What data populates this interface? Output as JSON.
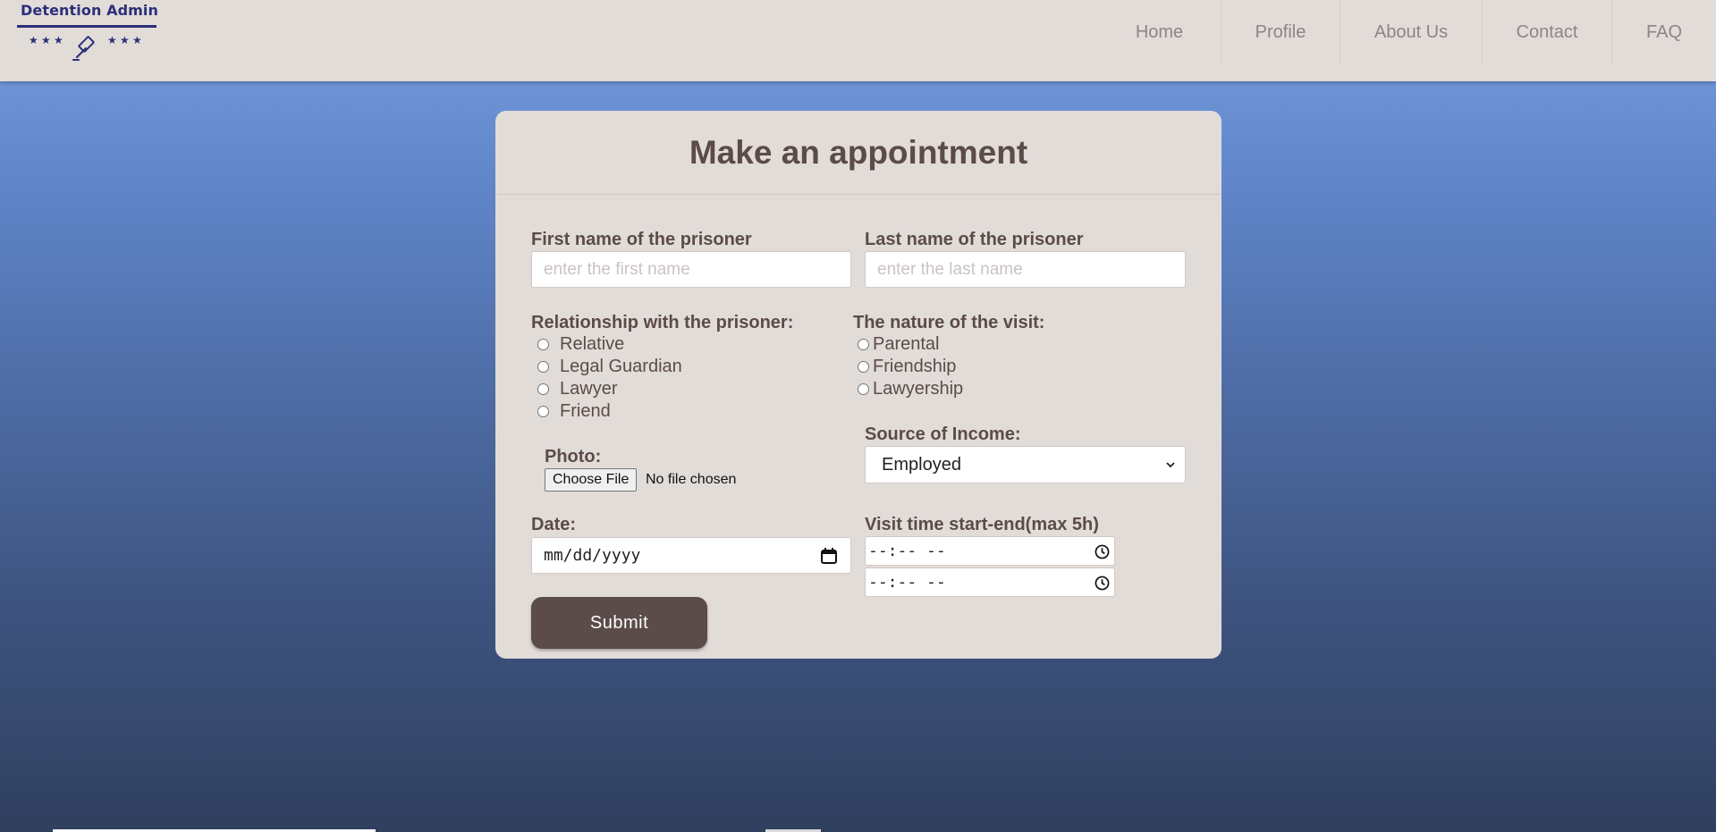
{
  "brand": {
    "name": "Detention Admin",
    "logo_icon": "gavel-icon",
    "accent_color": "#2a2f78"
  },
  "nav": {
    "items": [
      {
        "label": "Home"
      },
      {
        "label": "Profile"
      },
      {
        "label": "About Us"
      },
      {
        "label": "Contact"
      },
      {
        "label": "FAQ"
      }
    ]
  },
  "form": {
    "title": "Make an appointment",
    "first_name": {
      "label": "First name of the prisoner",
      "placeholder": "enter the first name",
      "value": ""
    },
    "last_name": {
      "label": "Last name of the prisoner",
      "placeholder": "enter the last name",
      "value": ""
    },
    "relationship": {
      "label": "Relationship with the prisoner:",
      "options": [
        "Relative",
        "Legal Guardian",
        "Lawyer",
        "Friend"
      ]
    },
    "visit_nature": {
      "label": "The nature of the visit:",
      "options": [
        "Parental",
        "Friendship",
        "Lawyership"
      ]
    },
    "photo": {
      "label": "Photo:",
      "button_label": "Choose File",
      "status": "No file chosen"
    },
    "income": {
      "label": "Source of Income:",
      "selected": "Employed"
    },
    "date": {
      "label": "Date:",
      "placeholder": "mm/dd/yyyy"
    },
    "visit_time": {
      "label": "Visit time start-end(max 5h)",
      "start_placeholder": "--:-- --",
      "end_placeholder": "--:-- --"
    },
    "submit_label": "Submit"
  },
  "colors": {
    "card_background": "#e2dcd9",
    "text_brown": "#5b4b49",
    "nav_text": "#8b8583"
  }
}
